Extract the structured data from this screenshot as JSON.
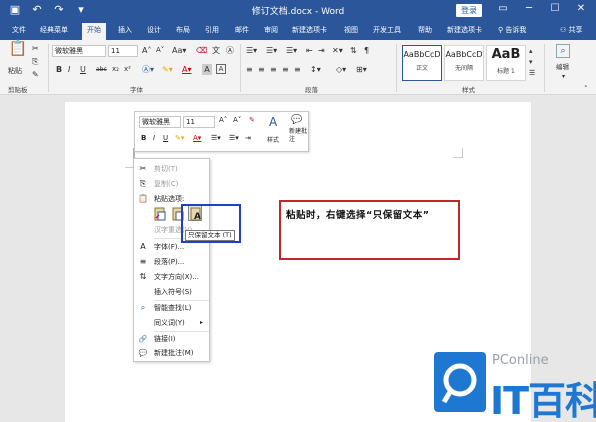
{
  "window": {
    "title": "修订文档.docx - Word",
    "login_label": "登录",
    "controls": [
      "▭",
      "─",
      "☐",
      "✕"
    ]
  },
  "qat": {
    "save_icon": "save-icon",
    "undo_icon": "undo-icon",
    "redo_icon": "redo-icon"
  },
  "tabs": [
    "文件",
    "经典菜单",
    "开始",
    "插入",
    "设计",
    "布局",
    "引用",
    "邮件",
    "审阅",
    "新建选项卡",
    "视图",
    "开发工具",
    "帮助",
    "新建选项卡",
    "告诉我",
    "共享"
  ],
  "active_tab": "开始",
  "ribbon": {
    "paste_label": "粘贴",
    "font_name": "微软雅黑",
    "font_size": "11",
    "groups": [
      "剪贴板",
      "字体",
      "段落",
      "样式",
      "编辑"
    ],
    "styles": [
      {
        "sample": "AaBbCcD",
        "name": "正文"
      },
      {
        "sample": "AaBbCcD",
        "name": "无间隔"
      },
      {
        "sample": "AaB",
        "name": "标题 1"
      }
    ],
    "edit_label": "编辑",
    "bold": "B",
    "italic": "I",
    "underline": "U",
    "strike": "abc",
    "sub": "x₂",
    "sup": "x²"
  },
  "mini_toolbar": {
    "font_name": "微软雅黑",
    "font_size": "11",
    "style_label": "样式",
    "new_comment_label": "新建批注"
  },
  "context_menu": {
    "items": [
      {
        "label": "剪切(T)",
        "icon": "scissors-icon",
        "glyph": "✂",
        "disabled": true
      },
      {
        "label": "复制(C)",
        "icon": "copy-icon",
        "glyph": "⎘",
        "disabled": true
      },
      {
        "label": "粘贴选项:",
        "icon": "clipboard-icon",
        "glyph": "📋",
        "disabled": false
      },
      {
        "label": "汉字重选(V)",
        "icon": "",
        "glyph": "",
        "disabled": true
      },
      {
        "label": "字体(F)...",
        "icon": "font-icon",
        "glyph": "A",
        "disabled": false
      },
      {
        "label": "段落(P)...",
        "icon": "paragraph-icon",
        "glyph": "≡",
        "disabled": false
      },
      {
        "label": "文字方向(X)...",
        "icon": "text-direction-icon",
        "glyph": "⇅",
        "disabled": false
      },
      {
        "label": "插入符号(S)",
        "icon": "",
        "glyph": "",
        "disabled": false
      },
      {
        "label": "智能查找(L)",
        "icon": "search-icon",
        "glyph": "⌕",
        "disabled": false
      },
      {
        "label": "同义词(Y)",
        "icon": "",
        "glyph": "",
        "disabled": false
      },
      {
        "label": "链接(I)",
        "icon": "link-icon",
        "glyph": "🔗",
        "disabled": false
      },
      {
        "label": "新建批注(M)",
        "icon": "comment-icon",
        "glyph": "💬",
        "disabled": false
      }
    ],
    "tooltip": "只保留文本 (T)"
  },
  "annotation": {
    "text": "粘贴时，右键选择“只保留文本”"
  },
  "watermark": {
    "brand": "PConline",
    "name": "IT百科"
  },
  "colors": {
    "word_blue": "#2b579a",
    "highlight_box": "#1f3fd1",
    "annotation_border": "#c0272d",
    "watermark_blue": "#1e78d2"
  }
}
